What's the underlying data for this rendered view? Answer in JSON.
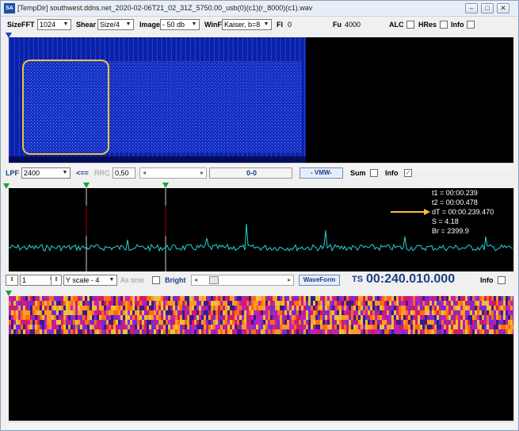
{
  "window": {
    "icon_text": "SA",
    "title": "[TempDir] southwest.ddns.net_2020-02-06T21_02_31Z_5750.00_usb(0)(c1)(r_8000)(c1).wav"
  },
  "toolbar": {
    "sizefft_label": "SizeFFT",
    "sizefft_value": "1024",
    "shear_label": "Shear",
    "shear_value": "Size/4",
    "image_label": "Image",
    "image_value": "- 50 db",
    "winf_label": "WinF",
    "winf_value": "Kaiser, b=8",
    "fl_label": "Fl",
    "fl_value": "0",
    "fu_label": "Fu",
    "fu_value": "4000",
    "alc_label": "ALC",
    "hres_label": "HRes",
    "info_label": "Info"
  },
  "filter_bar": {
    "lpf_label": "LPF",
    "lpf_value": "2400",
    "arrow_label": "<==",
    "rrc_label": "RRC",
    "rrc_value": "0,50",
    "range_value": "0-0",
    "vmw_label": "- VMW-",
    "sum_label": "Sum",
    "info_label": "Info",
    "info_checked": "✓"
  },
  "measurements": {
    "t1": "t1 = 00:00.239",
    "t2": "t2 = 00:00.478",
    "dt": "dT = 00:00.239.470",
    "s": "S = 4.18",
    "br": "Br = 2399.9"
  },
  "wave_bar": {
    "channel_value": "1",
    "yscale_value": "Y scale - 4",
    "astime_label": "As time",
    "bright_label": "Bright",
    "waveform_label": "WaveForm",
    "ts_label": "TS",
    "ts_value": "00:240.010.000",
    "info_label": "Info"
  },
  "colors": {
    "accent": "#1b3f86",
    "highlight": "#f2c23a",
    "wave": "#27d3d3",
    "marker": "#1aa33a"
  }
}
